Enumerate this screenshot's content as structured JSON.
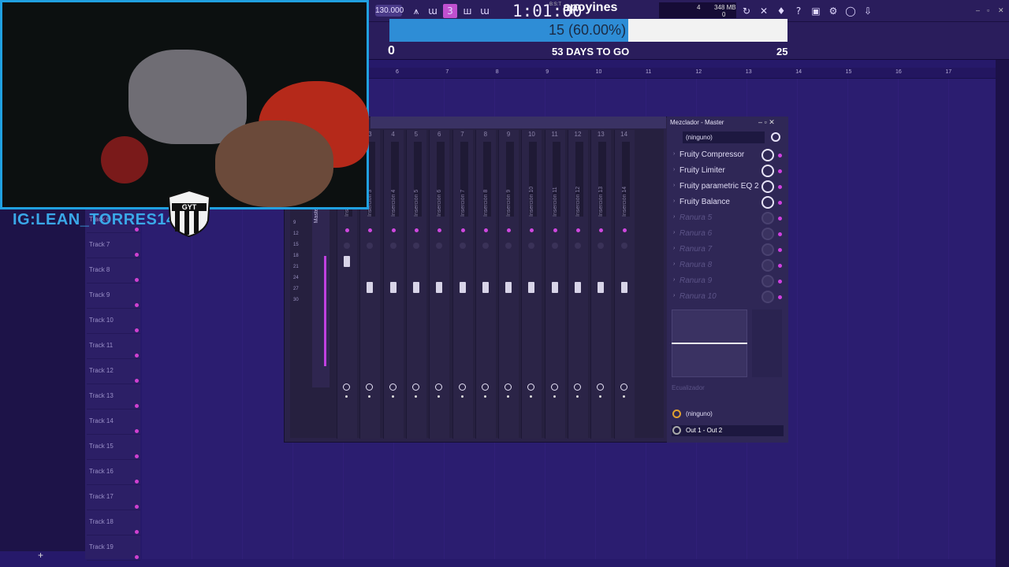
{
  "toolbar": {
    "tempo": "130.000",
    "time": "1:01:00",
    "time_sub": "B:S:T",
    "song_title": "apoyines",
    "cpu_text": "4",
    "memory": "348 MB",
    "memory_sub": "0",
    "icons": [
      "metronome-icon",
      "wait-icon",
      "countdown-icon",
      "loop-record-icon",
      "step-edit-icon",
      "blend-icon",
      "undo-icon",
      "cut-icon",
      "mic-icon",
      "help-icon",
      "save-icon",
      "plugin-icon",
      "chat-icon",
      "download-icon"
    ]
  },
  "goal": {
    "progress_text": "15 (60.00%)",
    "progress_fraction": 0.6,
    "min": "0",
    "days": "53 DAYS TO GO",
    "max": "25",
    "fill_color": "#2e8dd6"
  },
  "playlist": {
    "ruler": [
      "6",
      "7",
      "8",
      "9",
      "10",
      "11",
      "12",
      "13",
      "14",
      "15",
      "16",
      "17"
    ],
    "tracks": [
      "Track 6",
      "Track 7",
      "Track 8",
      "Track 9",
      "Track 10",
      "Track 11",
      "Track 12",
      "Track 13",
      "Track 14",
      "Track 15",
      "Track 16",
      "Track 17",
      "Track 18",
      "Track 19"
    ],
    "add_label": "+"
  },
  "overlay": {
    "handle": "IG:LEAN_TORRES14",
    "crest_text": "GYT"
  },
  "mixer": {
    "title": "Mezclador - Master",
    "preset": "(ninguno)",
    "master_label": "Master",
    "insert_numbers": [
      "2",
      "3",
      "4",
      "5",
      "6",
      "7",
      "8",
      "9",
      "10",
      "11",
      "12",
      "13",
      "14"
    ],
    "insert_labels": [
      "Insert 2",
      "Inserción 3",
      "Inserción 4",
      "Inserción 5",
      "Inserción 6",
      "Inserción 7",
      "Inserción 8",
      "Inserción 9",
      "Inserción 10",
      "Inserción 11",
      "Inserción 12",
      "Inserción 13",
      "Inserción 14"
    ],
    "scale": [
      "9",
      "12",
      "15",
      "18",
      "21",
      "24",
      "27",
      "30"
    ],
    "slots": [
      {
        "name": "Fruity Compressor",
        "filled": true
      },
      {
        "name": "Fruity Limiter",
        "filled": true
      },
      {
        "name": "Fruity parametric EQ 2",
        "filled": true
      },
      {
        "name": "Fruity Balance",
        "filled": true
      },
      {
        "name": "Ranura 5",
        "filled": false
      },
      {
        "name": "Ranura 6",
        "filled": false
      },
      {
        "name": "Ranura 7",
        "filled": false
      },
      {
        "name": "Ranura 8",
        "filled": false
      },
      {
        "name": "Ranura 9",
        "filled": false
      },
      {
        "name": "Ranura 10",
        "filled": false
      }
    ],
    "eq_label": "Ecualizador",
    "route_none": "(ninguno)",
    "output": "Out 1 - Out 2"
  }
}
